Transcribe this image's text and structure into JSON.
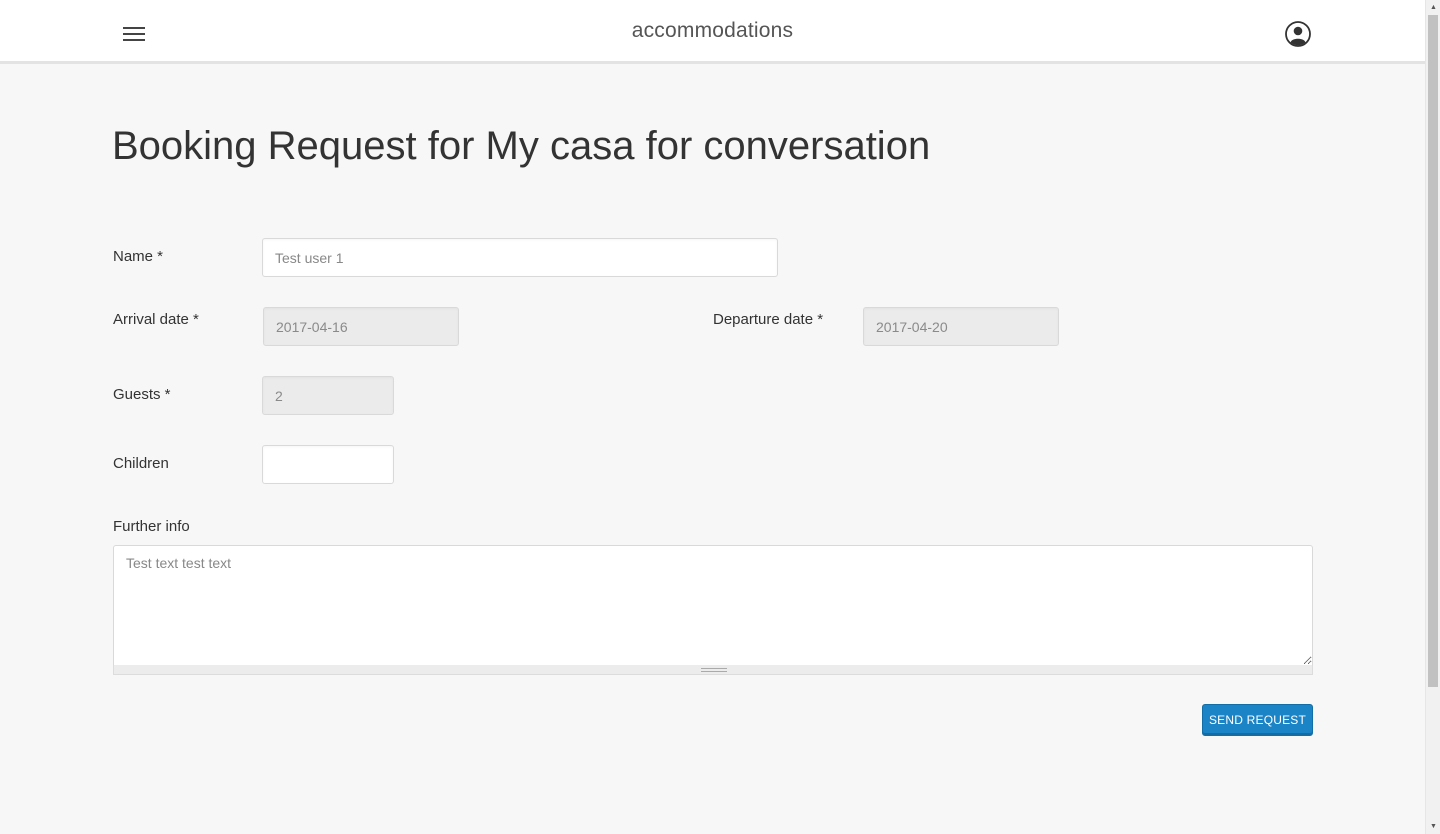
{
  "header": {
    "brand": "accommodations",
    "menu_icon": "hamburger-menu-icon",
    "user_icon": "user-account-icon"
  },
  "page": {
    "title": "Booking Request for My casa for conversation"
  },
  "form": {
    "name_label": "Name *",
    "name_value": "Test user 1",
    "arrival_label": "Arrival date *",
    "arrival_value": "2017-04-16",
    "departure_label": "Departure date *",
    "departure_value": "2017-04-20",
    "guests_label": "Guests *",
    "guests_value": "2",
    "children_label": "Children",
    "children_value": "",
    "further_info_label": "Further info",
    "further_info_value": "Test text test text",
    "send_label": "SEND REQUEST"
  },
  "colors": {
    "accent": "#1a84c7",
    "background": "#f7f7f7",
    "readonly_field": "#ebebeb"
  }
}
